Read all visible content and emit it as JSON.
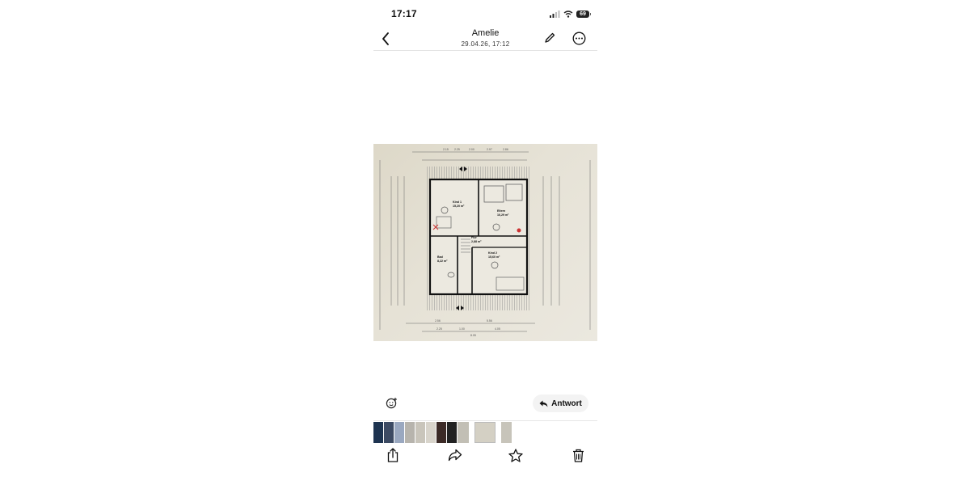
{
  "status_bar": {
    "time": "17:17",
    "battery": "69",
    "icons": [
      "signal-icon",
      "wifi-icon",
      "battery-icon"
    ]
  },
  "nav": {
    "title": "Amelie",
    "subtitle": "29.04.26, 17:12",
    "icons": [
      "chevron-left-icon",
      "pencil-icon",
      "more-icon"
    ]
  },
  "photo": {
    "rooms": [
      {
        "name": "Kind 1",
        "area": "15,20 m²"
      },
      {
        "name": "Eltern",
        "area": "16,29 m²"
      },
      {
        "name": "Flur",
        "area": "2,88 m²"
      },
      {
        "name": "Bad",
        "area": "8,22 m²"
      },
      {
        "name": "Kind 2",
        "area": "15,60 m²"
      }
    ],
    "dims_top": [
      "2.15",
      "2.25",
      "2.00",
      "2.97",
      "2.86"
    ],
    "dims_bottom": [
      "2.56",
      "5.56",
      "2.25",
      "1.00",
      "4.05",
      "8.05"
    ]
  },
  "reply": {
    "label": "Antwort"
  },
  "toolbar": {
    "icons": [
      "share-icon",
      "forward-icon",
      "star-icon",
      "trash-icon"
    ]
  },
  "colors": {
    "accent": "#111111",
    "paper": "#e5e1d5"
  }
}
